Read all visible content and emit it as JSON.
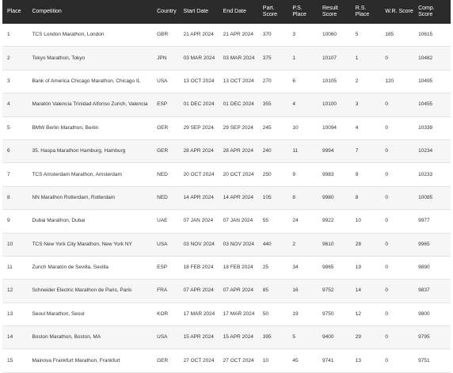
{
  "table": {
    "headers": {
      "place": "Place",
      "competition": "Competition",
      "country": "Country",
      "start_date": "Start Date",
      "end_date": "End Date",
      "part_score": "Part. Score",
      "ps_place": "P.S. Place",
      "result_score": "Result Score",
      "rs_place": "R.S. Place",
      "wr_score": "W.R. Score",
      "comp_score": "Comp. Score"
    },
    "rows": [
      {
        "place": "1",
        "competition": "TCS London Marathon, London",
        "country": "GBR",
        "start_date": "21 APR 2024",
        "end_date": "21 APR 2024",
        "part_score": "370",
        "ps_place": "3",
        "result_score": "10060",
        "rs_place": "5",
        "wr_score": "185",
        "comp_score": "10615"
      },
      {
        "place": "2",
        "competition": "Tokyo Marathon, Tokyo",
        "country": "JPN",
        "start_date": "03 MAR 2024",
        "end_date": "03 MAR 2024",
        "part_score": "375",
        "ps_place": "1",
        "result_score": "10107",
        "rs_place": "1",
        "wr_score": "0",
        "comp_score": "10482"
      },
      {
        "place": "3",
        "competition": "Bank of America Chicago Marathon, Chicago IL",
        "country": "USA",
        "start_date": "13 OCT 2024",
        "end_date": "13 OCT 2024",
        "part_score": "270",
        "ps_place": "6",
        "result_score": "10105",
        "rs_place": "2",
        "wr_score": "120",
        "comp_score": "10495"
      },
      {
        "place": "4",
        "competition": "Maratón Valencia Trinidad Alfonso Zurich, Valencia",
        "country": "ESP",
        "start_date": "01 DEC 2024",
        "end_date": "01 DEC 2024",
        "part_score": "355",
        "ps_place": "4",
        "result_score": "10100",
        "rs_place": "3",
        "wr_score": "0",
        "comp_score": "10455"
      },
      {
        "place": "5",
        "competition": "BMW Berlin Marathon, Berlin",
        "country": "GER",
        "start_date": "29 SEP 2024",
        "end_date": "29 SEP 2024",
        "part_score": "245",
        "ps_place": "10",
        "result_score": "10094",
        "rs_place": "4",
        "wr_score": "0",
        "comp_score": "10339"
      },
      {
        "place": "6",
        "competition": "35. Haspa Marathon Hamburg, Hamburg",
        "country": "GER",
        "start_date": "28 APR 2024",
        "end_date": "28 APR 2024",
        "part_score": "240",
        "ps_place": "11",
        "result_score": "9994",
        "rs_place": "7",
        "wr_score": "0",
        "comp_score": "10234"
      },
      {
        "place": "7",
        "competition": "TCS Amsterdam Marathon, Amsterdam",
        "country": "NED",
        "start_date": "20 OCT 2024",
        "end_date": "20 OCT 2024",
        "part_score": "250",
        "ps_place": "9",
        "result_score": "9983",
        "rs_place": "9",
        "wr_score": "0",
        "comp_score": "10233"
      },
      {
        "place": "8",
        "competition": "NN Marathon Rotterdam, Rotterdam",
        "country": "NED",
        "start_date": "14 APR 2024",
        "end_date": "14 APR 2024",
        "part_score": "105",
        "ps_place": "8",
        "result_score": "9980",
        "rs_place": "8",
        "wr_score": "0",
        "comp_score": "10085"
      },
      {
        "place": "9",
        "competition": "Dubai Marathon, Dubai",
        "country": "UAE",
        "start_date": "07 JAN 2024",
        "end_date": "07 JAN 2024",
        "part_score": "55",
        "ps_place": "24",
        "result_score": "9922",
        "rs_place": "10",
        "wr_score": "0",
        "comp_score": "9977"
      },
      {
        "place": "10",
        "competition": "TCS New York City Marathon, New York NY",
        "country": "USA",
        "start_date": "03 NOV 2024",
        "end_date": "03 NOV 2024",
        "part_score": "440",
        "ps_place": "2",
        "result_score": "9610",
        "rs_place": "28",
        "wr_score": "0",
        "comp_score": "9965"
      },
      {
        "place": "11",
        "competition": "Zurich Maratón de Sevilla, Sevilla",
        "country": "ESP",
        "start_date": "18 FEB 2024",
        "end_date": "18 FEB 2024",
        "part_score": "25",
        "ps_place": "34",
        "result_score": "9865",
        "rs_place": "19",
        "wr_score": "0",
        "comp_score": "9890"
      },
      {
        "place": "12",
        "competition": "Schneider Electric Marathon de Paris, Paris",
        "country": "FRA",
        "start_date": "07 APR 2024",
        "end_date": "07 APR 2024",
        "part_score": "85",
        "ps_place": "16",
        "result_score": "9752",
        "rs_place": "14",
        "wr_score": "0",
        "comp_score": "9837"
      },
      {
        "place": "13",
        "competition": "Seoul Marathon, Seoul",
        "country": "KOR",
        "start_date": "17 MAR 2024",
        "end_date": "17 MAR 2024",
        "part_score": "50",
        "ps_place": "19",
        "result_score": "9750",
        "rs_place": "12",
        "wr_score": "0",
        "comp_score": "9800"
      },
      {
        "place": "14",
        "competition": "Boston Marathon, Boston, MA",
        "country": "USA",
        "start_date": "15 APR 2024",
        "end_date": "15 APR 2024",
        "part_score": "395",
        "ps_place": "5",
        "result_score": "9400",
        "rs_place": "29",
        "wr_score": "0",
        "comp_score": "9795"
      },
      {
        "place": "15",
        "competition": "Mainova Frankfurt Marathon, Frankfurt",
        "country": "GER",
        "start_date": "27 OCT 2024",
        "end_date": "27 OCT 2024",
        "part_score": "10",
        "ps_place": "45",
        "result_score": "9741",
        "rs_place": "13",
        "wr_score": "0",
        "comp_score": "9751"
      }
    ]
  }
}
